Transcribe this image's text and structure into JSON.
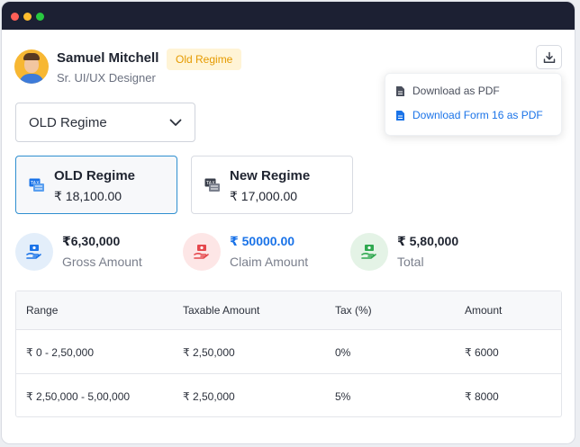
{
  "user": {
    "name": "Samuel Mitchell",
    "role": "Sr. UI/UX Designer",
    "badge": "Old Regime"
  },
  "download_menu": {
    "items": [
      {
        "label": "Download as PDF"
      },
      {
        "label": "Download Form 16 as PDF"
      }
    ]
  },
  "regime_select": {
    "value": "OLD Regime"
  },
  "regime_cards": [
    {
      "title": "OLD Regime",
      "amount": "₹ 18,100.00",
      "icon": "tax-icon"
    },
    {
      "title": "New Regime",
      "amount": "₹ 17,000.00",
      "icon": "tax-icon"
    }
  ],
  "stats": [
    {
      "value": "₹6,30,000",
      "label": "Gross Amount",
      "icon": "money-hand-icon",
      "color": "#1a73e8"
    },
    {
      "value": "₹ 50000.00",
      "label": "Claim Amount",
      "icon": "money-hand-icon",
      "color": "#e5484d"
    },
    {
      "value": "₹ 5,80,000",
      "label": "Total",
      "icon": "money-hand-icon",
      "color": "#2fa84f"
    }
  ],
  "table": {
    "headers": [
      "Range",
      "Taxable Amount",
      "Tax (%)",
      "Amount"
    ],
    "rows": [
      [
        "₹ 0 - 2,50,000",
        "₹ 2,50,000",
        "0%",
        "₹ 6000"
      ],
      [
        "₹ 2,50,000 - 5,00,000",
        "₹ 2,50,000",
        "5%",
        "₹ 8000"
      ]
    ]
  },
  "colors": {
    "accent": "#1a73e8",
    "badge_text": "#e59a00",
    "badge_bg": "#fff4d6",
    "titlebar": "#1c2033"
  }
}
